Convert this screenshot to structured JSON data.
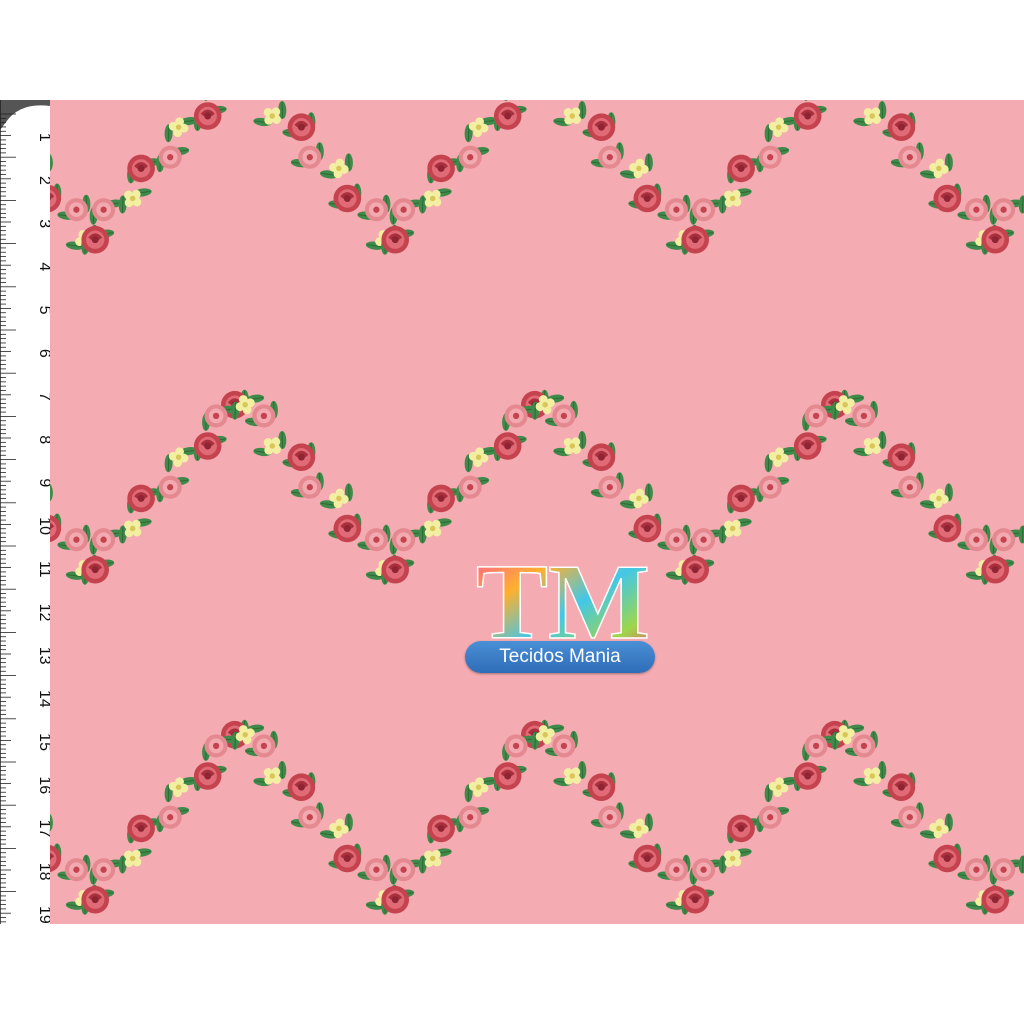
{
  "ruler": {
    "labels": [
      "1",
      "2",
      "3",
      "4",
      "5",
      "6",
      "7",
      "8",
      "9",
      "10",
      "11",
      "12",
      "13",
      "14",
      "15",
      "16",
      "17",
      "18",
      "19"
    ],
    "unit_icon": "ruler-icon"
  },
  "fabric": {
    "background_color": "#f4abb1",
    "motif": "rose-garland-lattice",
    "rose_dark": "#c5434f",
    "rose_light": "#e58990",
    "blossom": "#f3efa2",
    "leaf": "#3f8a4a"
  },
  "logo": {
    "monogram": "TM",
    "brand_name": "Tecidos Mania",
    "pill_color": "#2f6db8"
  }
}
